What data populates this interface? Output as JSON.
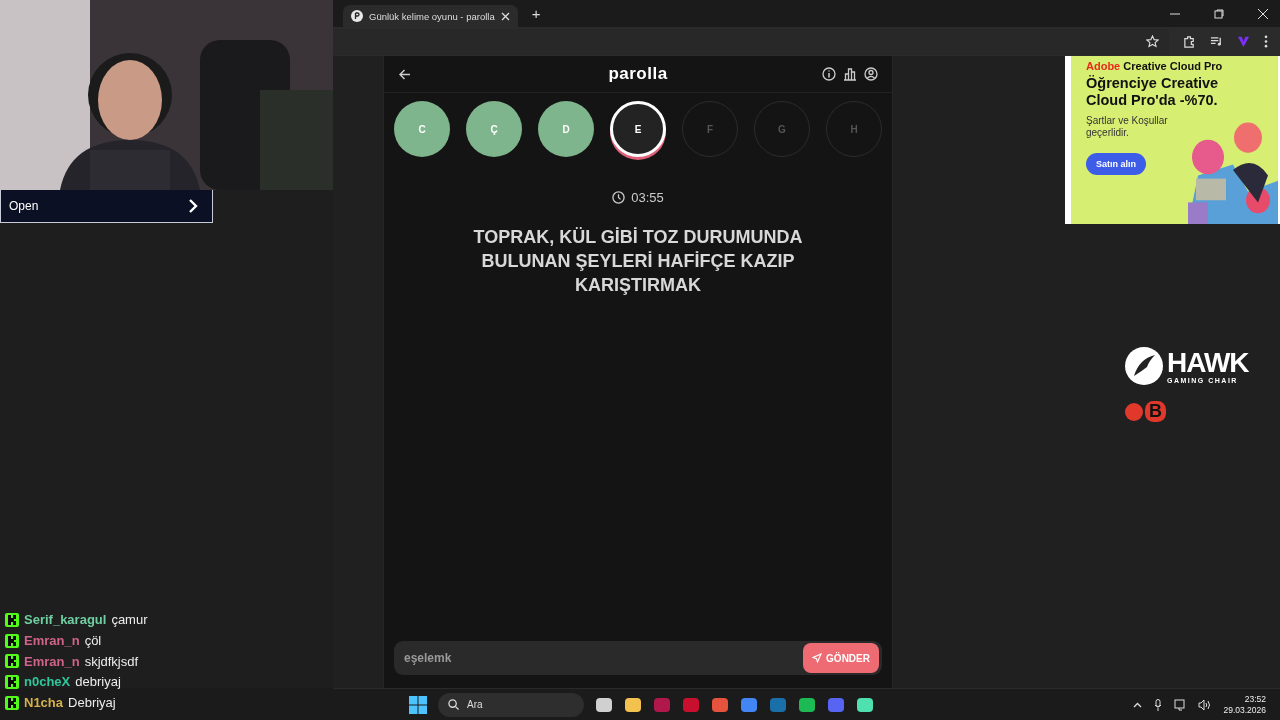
{
  "webcam": {
    "button": "Open"
  },
  "chat": [
    {
      "user": "Serif_karagul",
      "color": "#6fcfa0",
      "message": "çamur"
    },
    {
      "user": "Emran_n",
      "color": "#d0638a",
      "message": "çöl"
    },
    {
      "user": "Emran_n",
      "color": "#d0638a",
      "message": "skjdfkjsdf"
    },
    {
      "user": "n0cheX",
      "color": "#2fc79a",
      "message": "debriyaj"
    },
    {
      "user": "N1cha",
      "color": "#d4b24a",
      "message": "Debriyaj"
    }
  ],
  "browser": {
    "tab": "Günlük kelime oyunu - parolla",
    "new_tab": "+"
  },
  "game": {
    "title": "parolla",
    "letters": [
      {
        "letter": "C",
        "kind": "correct"
      },
      {
        "letter": "Ç",
        "kind": "correct"
      },
      {
        "letter": "D",
        "kind": "correct"
      },
      {
        "letter": "E",
        "kind": "current"
      },
      {
        "letter": "F",
        "kind": "pending"
      },
      {
        "letter": "G",
        "kind": "pending"
      },
      {
        "letter": "H",
        "kind": "pending"
      }
    ],
    "timer": "03:55",
    "question": "TOPRAK, KÜL GİBİ TOZ DURUMUNDA BULUNAN ŞEYLERİ HAFİFÇE KAZIP KARIŞTIRMAK",
    "answer": "eşelemk",
    "submit": "GÖNDER"
  },
  "ad": {
    "brand": "Adobe",
    "product": "Creative Cloud Pro",
    "headline": "Öğrenciye Creative Cloud Pro'da -%70.",
    "terms": "Şartlar ve Koşullar geçerlidir.",
    "button": "Satın alın"
  },
  "sponsors": {
    "hawk": "HAWK",
    "hawk_sub": "GAMING CHAIR",
    "b": "B"
  },
  "taskbar": {
    "search": "Ara",
    "time": "23:52",
    "date": "29.03.2026"
  }
}
